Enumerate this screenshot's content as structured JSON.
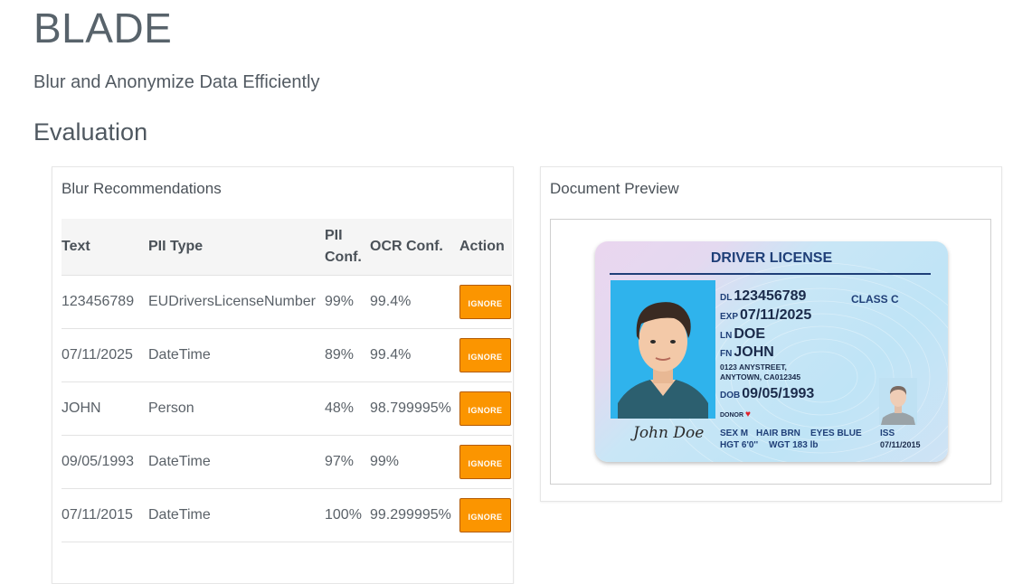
{
  "app": {
    "title": "BLADE",
    "subtitle": "Blur and Anonymize Data Efficiently",
    "section": "Evaluation"
  },
  "recommendations": {
    "title": "Blur Recommendations",
    "headers": {
      "text": "Text",
      "pii_type": "PII Type",
      "pii_conf_1": "PII",
      "pii_conf_2": "Conf.",
      "ocr_conf": "OCR Conf.",
      "action": "Action"
    },
    "rows": [
      {
        "text": "123456789",
        "pii_type": "EUDriversLicenseNumber",
        "pii_conf": "99%",
        "ocr_conf": "99.4%",
        "action": "IGNORE"
      },
      {
        "text": "07/11/2025",
        "pii_type": "DateTime",
        "pii_conf": "89%",
        "ocr_conf": "99.4%",
        "action": "IGNORE"
      },
      {
        "text": "JOHN",
        "pii_type": "Person",
        "pii_conf": "48%",
        "ocr_conf": "98.799995%",
        "action": "IGNORE"
      },
      {
        "text": "09/05/1993",
        "pii_type": "DateTime",
        "pii_conf": "97%",
        "ocr_conf": "99%",
        "action": "IGNORE"
      },
      {
        "text": "07/11/2015",
        "pii_type": "DateTime",
        "pii_conf": "100%",
        "ocr_conf": "99.299995%",
        "action": "IGNORE"
      }
    ]
  },
  "preview": {
    "title": "Document Preview",
    "license": {
      "heading": "DRIVER LICENSE",
      "dl_label": "DL",
      "dl": "123456789",
      "class": "CLASS C",
      "exp_label": "EXP",
      "exp": "07/11/2025",
      "ln_label": "LN",
      "ln": "DOE",
      "fn_label": "FN",
      "fn": "JOHN",
      "address1": "0123 ANYSTREET,",
      "address2": "ANYTOWN, CA012345",
      "dob_label": "DOB",
      "dob": "09/05/1993",
      "donor": "DONOR",
      "sex": "SEX M",
      "hair": "HAIR BRN",
      "eyes": "EYES BLUE",
      "hgt": "HGT 6'0''",
      "wgt": "WGT 183 lb",
      "iss_label": "ISS",
      "iss": "07/11/2015",
      "signature": "John Doe"
    }
  },
  "colors": {
    "accent": "#fb9500",
    "license_text": "#1f3f78",
    "photo_bg": "#2fb3ec"
  }
}
